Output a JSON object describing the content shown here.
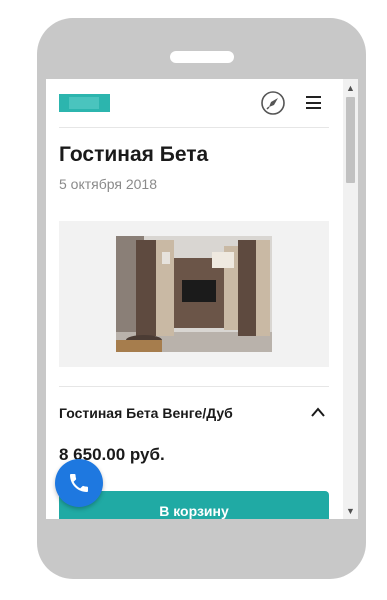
{
  "header": {
    "logo_icon": "site-logo",
    "rocket_icon": "rocket-icon",
    "menu_icon": "hamburger-menu-icon"
  },
  "product": {
    "title": "Гостиная Бета",
    "date": "5 октября 2018",
    "image_icon": "living-room-furniture-photo",
    "variant_name": "Гостиная Бета Венге/Дуб",
    "price": "8 650.00 руб.",
    "cart_button_label": "В корзину"
  },
  "floating": {
    "call_icon": "phone-icon"
  },
  "colors": {
    "accent": "#20aaa4",
    "call_button": "#1e78e0",
    "device_frame": "#c8c8c8"
  }
}
